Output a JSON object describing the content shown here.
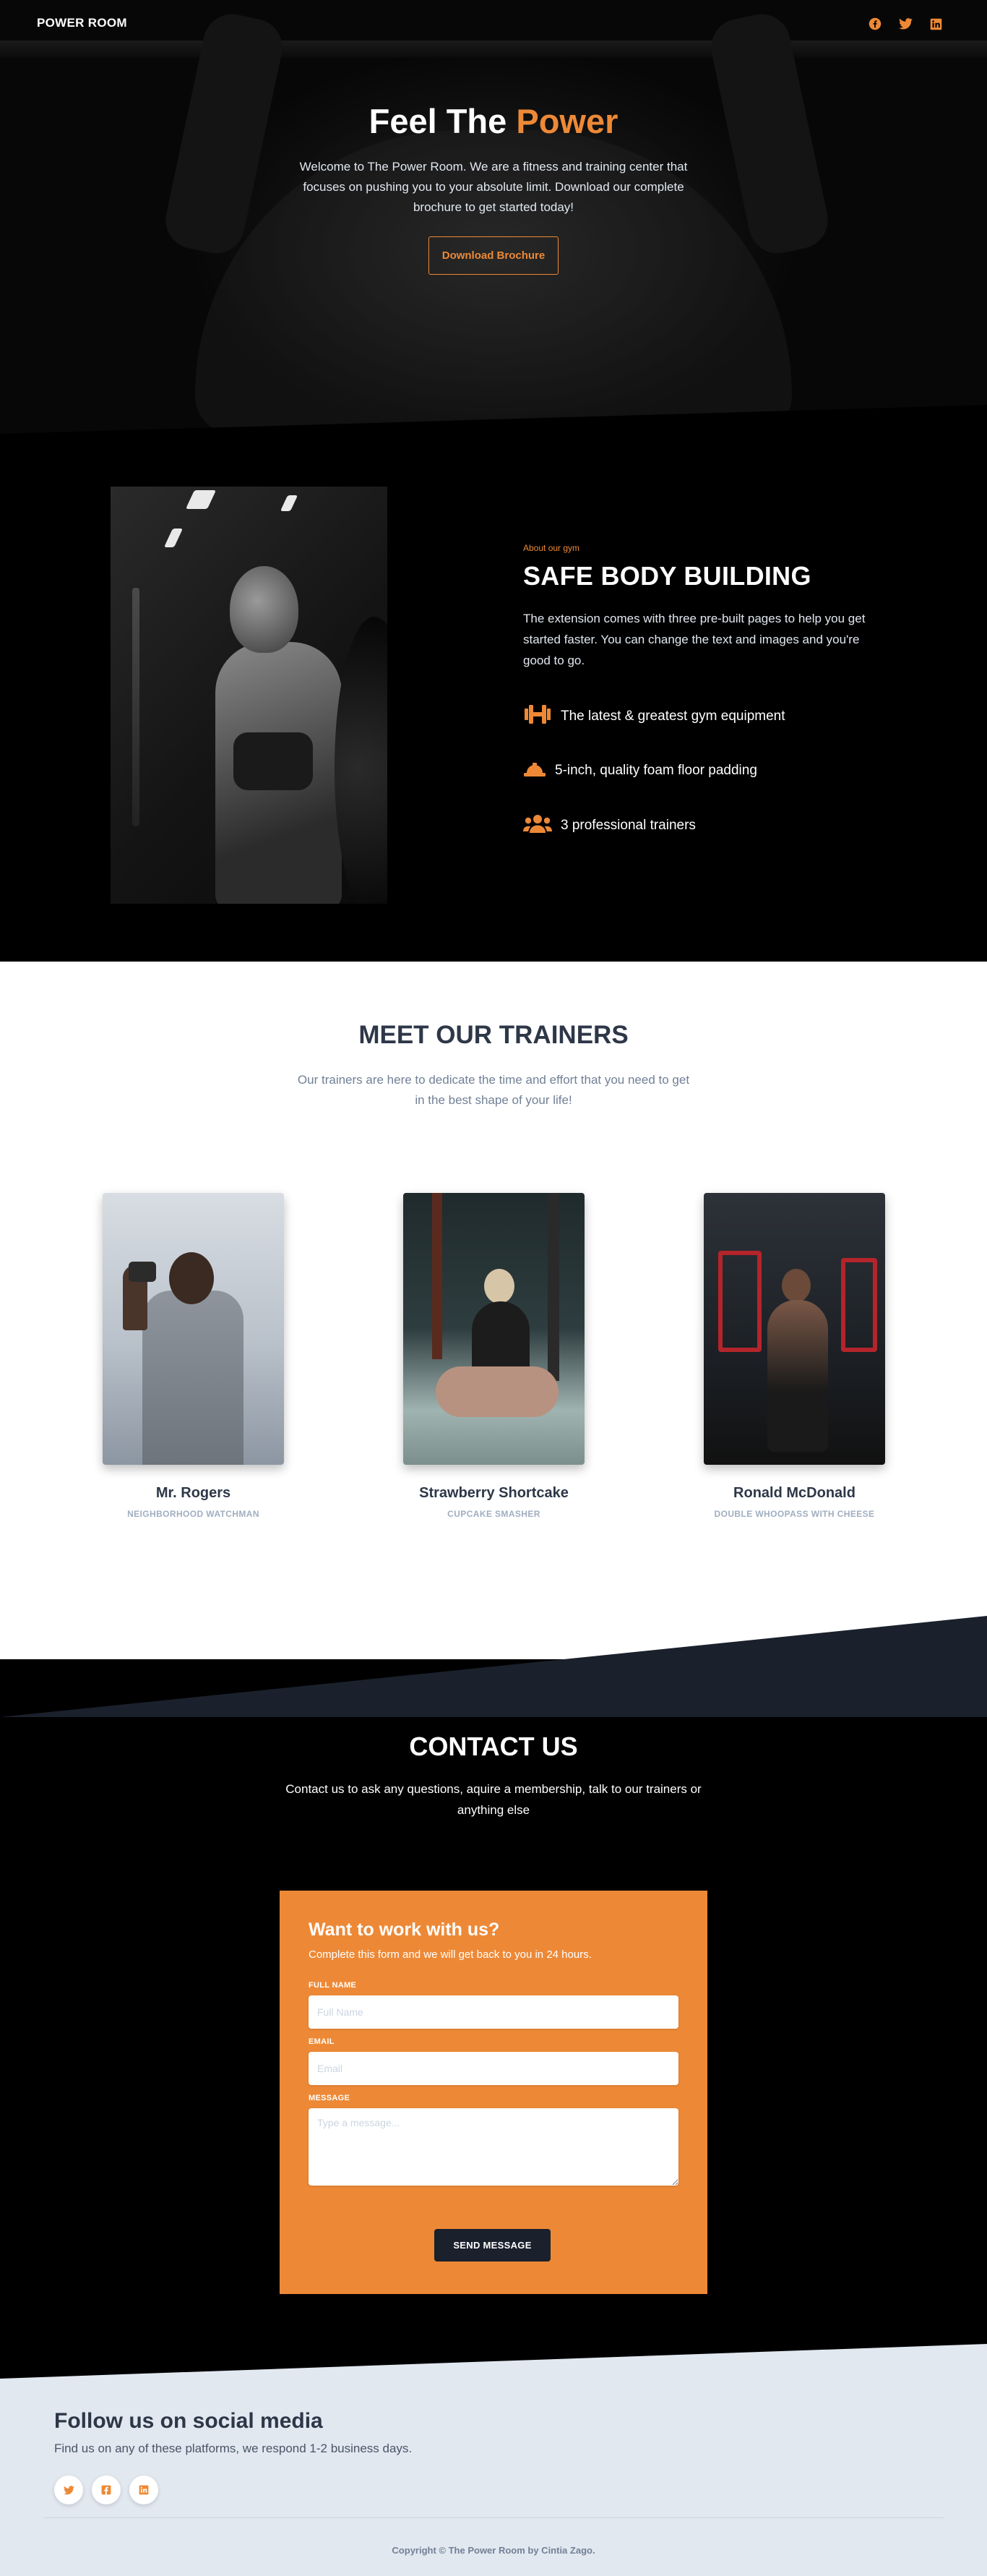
{
  "nav": {
    "brand": "POWER ROOM",
    "social_icons": [
      "facebook-icon",
      "twitter-icon",
      "linkedin-icon"
    ]
  },
  "hero": {
    "title_lead": "Feel The ",
    "title_accent": "Power",
    "text": "Welcome to The Power Room. We are a fitness and training center that focuses on pushing you to your absolute limit. Download our complete brochure to get started today!",
    "button": "Download Brochure"
  },
  "about": {
    "kicker": "About our gym",
    "heading": "SAFE BODY BUILDING",
    "text": "The extension comes with three pre-built pages to help you get started faster. You can change the text and images and you're good to go.",
    "features": [
      {
        "icon": "dumbbell-icon",
        "label": "The latest & greatest gym equipment"
      },
      {
        "icon": "hard-hat-icon",
        "label": "5-inch, quality foam floor padding"
      },
      {
        "icon": "users-icon",
        "label": "3 professional trainers"
      }
    ]
  },
  "trainers": {
    "heading": "MEET OUR TRAINERS",
    "text": "Our trainers are here to dedicate the time and effort that you need to get in the best shape of your life!",
    "items": [
      {
        "name": "Mr. Rogers",
        "role": "NEIGHBORHOOD WATCHMAN"
      },
      {
        "name": "Strawberry Shortcake",
        "role": "CUPCAKE SMASHER"
      },
      {
        "name": "Ronald McDonald",
        "role": "DOUBLE WHOOPASS WITH CHEESE"
      }
    ]
  },
  "contact": {
    "heading": "CONTACT US",
    "text": "Contact us to ask any questions, aquire a membership, talk to our trainers or anything else",
    "form": {
      "title": "Want to work with us?",
      "subtitle": "Complete this form and we will get back to you in 24 hours.",
      "name_label": "FULL NAME",
      "name_placeholder": "Full Name",
      "email_label": "EMAIL",
      "email_placeholder": "Email",
      "message_label": "MESSAGE",
      "message_placeholder": "Type a message...",
      "submit": "SEND MESSAGE"
    }
  },
  "footer": {
    "heading": "Follow us on social media",
    "text": "Find us on any of these platforms, we respond 1-2 business days.",
    "social_icons": [
      "twitter-icon",
      "facebook-icon",
      "linkedin-icon"
    ],
    "copyright": "Copyright © The Power Room by Cintia Zago."
  },
  "colors": {
    "accent": "#ed8936",
    "dark": "#1a202c",
    "heading": "#2d3748",
    "muted": "#718096",
    "footer_bg": "#e2e8f0"
  }
}
